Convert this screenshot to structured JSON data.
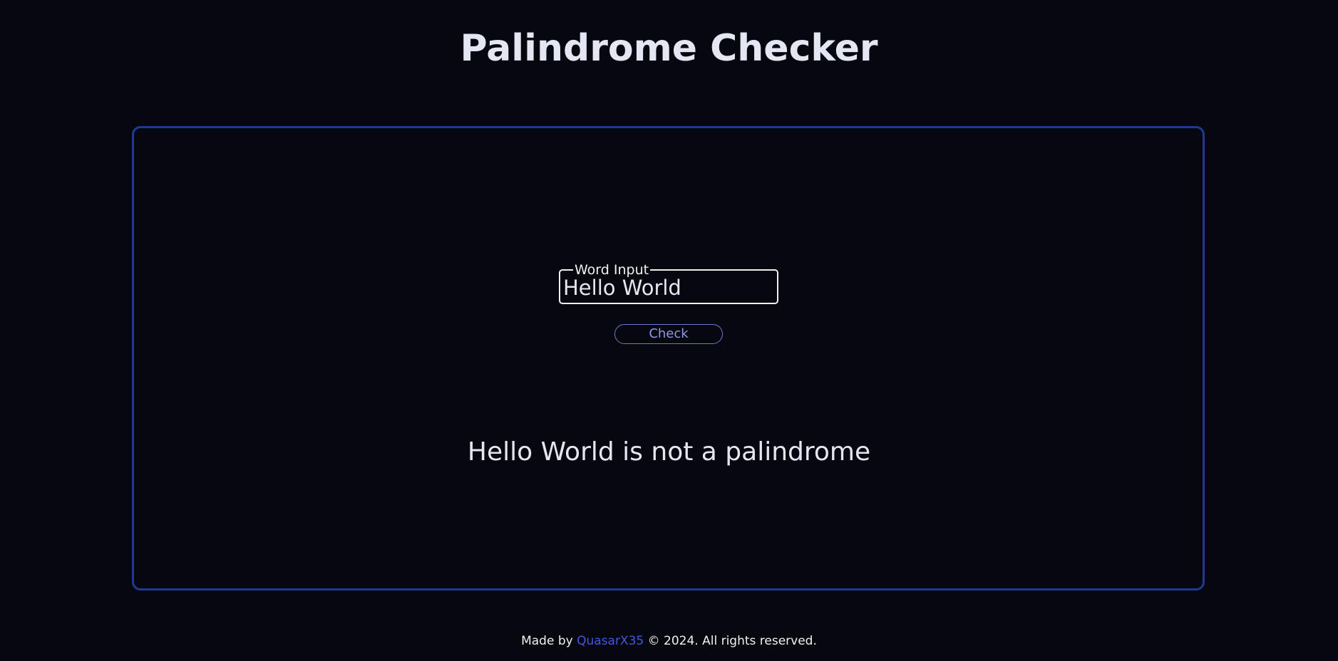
{
  "header": {
    "title": "Palindrome Checker"
  },
  "form": {
    "input_legend": "Word Input",
    "input_value": "Hello World",
    "check_button_label": "Check"
  },
  "result": {
    "text": "Hello World is not a palindrome"
  },
  "footer": {
    "made_by": "Made by",
    "author": "QuasarX35",
    "rights": "© 2024. All rights reserved."
  },
  "colors": {
    "background": "#07080f",
    "card_border": "#1e3a96",
    "button_border": "#6b78cc",
    "link": "#4257e0"
  }
}
